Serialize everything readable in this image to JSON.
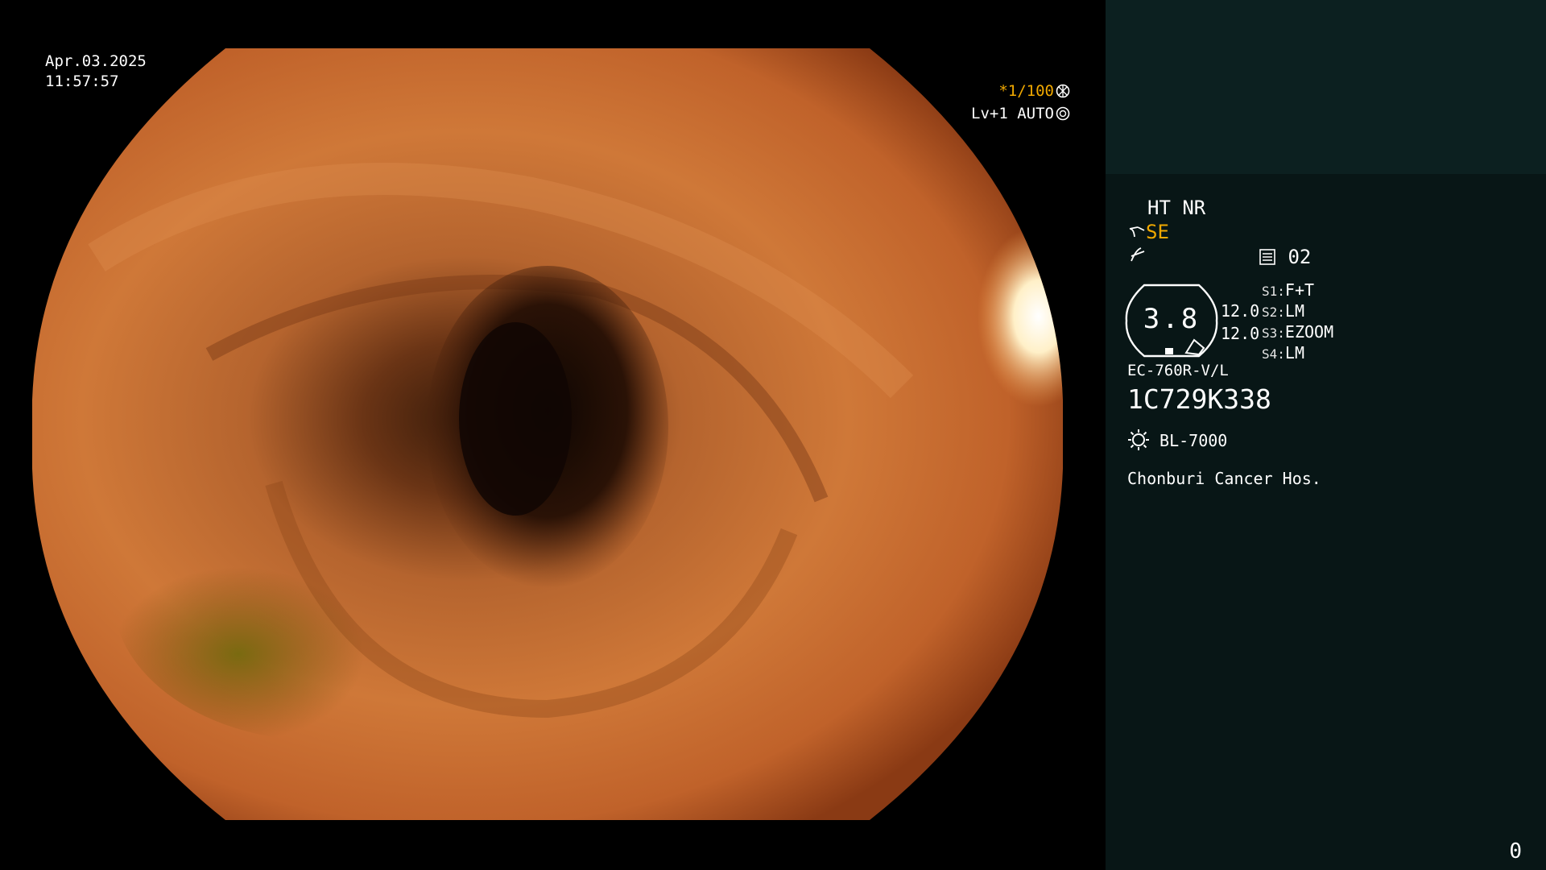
{
  "overlay": {
    "date": "Apr.03.2025",
    "time": "11:57:57",
    "shutter": "*1/100",
    "level": "Lv+1 AUTO"
  },
  "info_panel": {
    "mode": "HT NR",
    "enhance_label": "SE",
    "color_mode": "02",
    "lens_value": "3.8",
    "brightness_values": [
      "12.0",
      "12.0"
    ],
    "switches": [
      {
        "key": "S1:",
        "value": "F+T"
      },
      {
        "key": "S2:",
        "value": "LM"
      },
      {
        "key": "S3:",
        "value": "EZOOM"
      },
      {
        "key": "S4:",
        "value": "LM"
      }
    ],
    "scope_model": "EC-760R-V/L",
    "serial_number": "1C729K338",
    "light_source": "BL-7000",
    "hospital": "Chonburi Cancer Hos.",
    "counter": "0"
  },
  "icons": [
    "aperture-icon",
    "iris-icon",
    "scope-icon",
    "lightning-icon",
    "color-mode-icon",
    "lamp-icon"
  ],
  "colors": {
    "accent": "#f0a800",
    "panel_bg": "#081616",
    "patient_block_bg": "#0c2020"
  }
}
